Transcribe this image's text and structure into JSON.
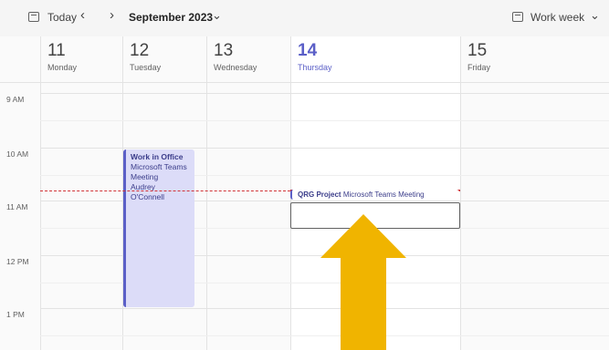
{
  "toolbar": {
    "today_label": "Today",
    "prev_glyph": "‹",
    "next_glyph": "›",
    "month_label": "September 2023",
    "chevron_glyph": "⌄",
    "view_label": "Work week"
  },
  "days": [
    {
      "num": "11",
      "name": "Monday"
    },
    {
      "num": "12",
      "name": "Tuesday"
    },
    {
      "num": "13",
      "name": "Wednesday"
    },
    {
      "num": "14",
      "name": "Thursday"
    },
    {
      "num": "15",
      "name": "Friday"
    }
  ],
  "times": [
    "9 AM",
    "10 AM",
    "11 AM",
    "12 PM",
    "1 PM"
  ],
  "events": {
    "work_in_office": {
      "title": "Work in Office",
      "line1": "Microsoft Teams",
      "line2": "Meeting",
      "line3": "Audrey",
      "line4": "O'Connell"
    },
    "qrg": {
      "title": "QRG Project",
      "subtitle": "Microsoft Teams Meeting"
    }
  },
  "colors": {
    "accent": "#5b5fc7",
    "event_bg": "#dcdcf8",
    "now_line": "#d13438",
    "arrow": "#f0b400"
  },
  "icons": {
    "today": "calendar-today-icon",
    "view": "calendar-view-icon",
    "annotation": "up-arrow-annotation"
  }
}
